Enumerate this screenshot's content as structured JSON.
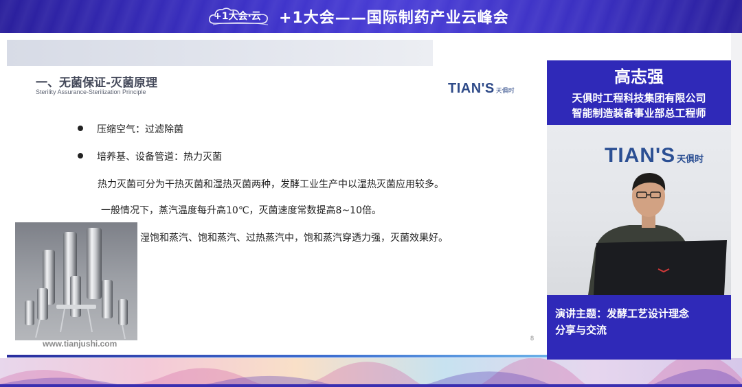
{
  "banner": {
    "logo_text": "+1大会·云",
    "title": "+1大会——国际制药产业云峰会"
  },
  "slide": {
    "title": "一、无菌保证-灭菌原理",
    "subtitle": "Sterility Assurance-Sterilization Principle",
    "logo_brand": "TIAN'S",
    "logo_cn": "天俱时",
    "bullets": [
      "压缩空气：过滤除菌",
      "培养基、设备管道：热力灭菌"
    ],
    "paragraphs": [
      "热力灭菌可分为干热灭菌和湿热灭菌两种，发酵工业生产中以湿热灭菌应用较多。",
      "一般情况下，蒸汽温度每升高10℃，灭菌速度常数提高8~10倍。",
      "湿饱和蒸汽、饱和蒸汽、过热蒸汽中，饱和蒸汽穿透力强，灭菌效果好。"
    ],
    "website": "www.tianjushi.com",
    "page_number": "8"
  },
  "speaker": {
    "name": "高志强",
    "organization": "天俱时工程科技集团有限公司",
    "role": "智能制造装备事业部总工程师",
    "video_logo_brand": "TIAN'S",
    "video_logo_cn": "天俱时",
    "topic_label": "演讲主题：",
    "topic_text_line1": "发酵工艺设计理念",
    "topic_text_line2": "分享与交流"
  },
  "colors": {
    "banner_blue": "#3e33c9",
    "panel_blue": "#2f29b8",
    "brand_blue": "#2e4a88"
  }
}
